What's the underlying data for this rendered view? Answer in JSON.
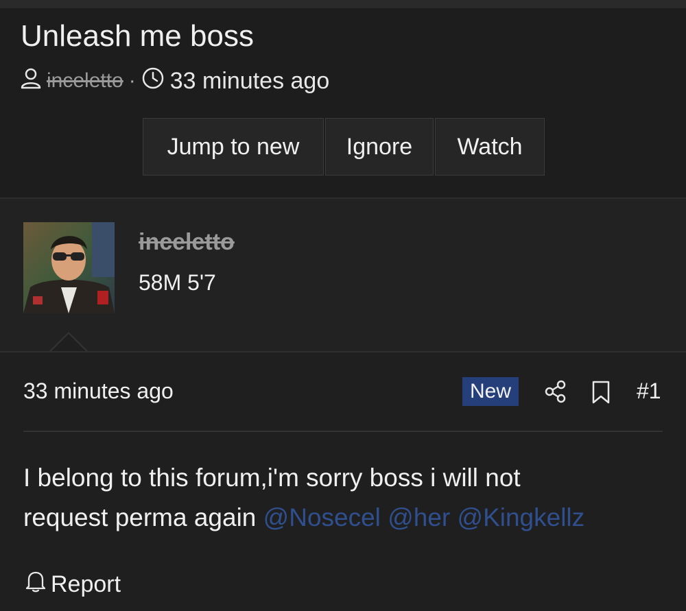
{
  "thread": {
    "title": "Unleash me boss",
    "author": "inceletto",
    "time": "33 minutes ago",
    "actions": {
      "jump_label": "Jump to new",
      "ignore_label": "Ignore",
      "watch_label": "Watch"
    }
  },
  "user": {
    "name": "inceletto",
    "title": "58M 5'7"
  },
  "post": {
    "time": "33 minutes ago",
    "badge": "New",
    "number": "#1",
    "body_line1": "I belong to this forum,i'm sorry boss i will not",
    "body_line2_text": "request perma again ",
    "mentions": [
      "@Nosecel",
      "@her",
      "@Kingkellz"
    ],
    "report_label": "Report"
  },
  "colors": {
    "background": "#1f1f1f",
    "badge": "#253f7a",
    "mention": "#2f4f8f",
    "muted_username": "#9a9a9a"
  },
  "icons": {
    "author": "user-icon",
    "time": "clock-icon",
    "share": "share-icon",
    "bookmark": "bookmark-icon",
    "report": "bell-icon"
  }
}
